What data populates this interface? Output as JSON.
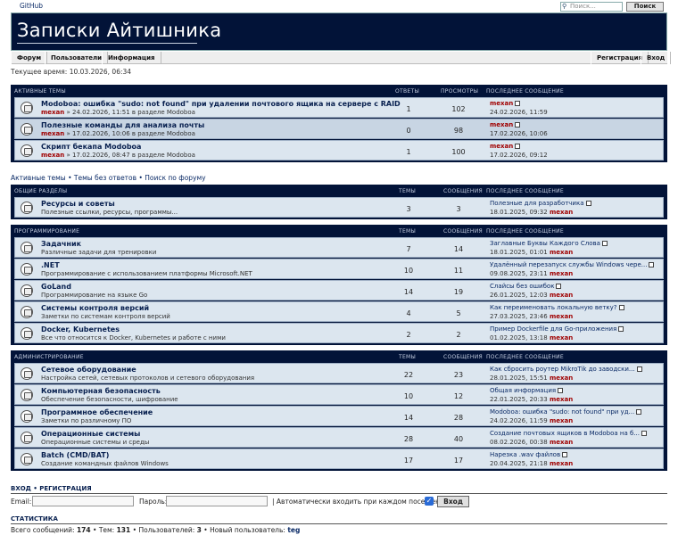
{
  "top": {
    "github": "GitHub",
    "search_placeholder": "Поиск...",
    "search_button": "Поиск"
  },
  "site_title": "Записки Айтишника",
  "nav": {
    "forum": "Форум",
    "users": "Пользователи",
    "info": "Информация",
    "register": "Регистрация",
    "login": "Вход"
  },
  "current_time": "Текущее время: 10.03.2026, 06:34",
  "active": {
    "headers": {
      "section": "АКТИВНЫЕ ТЕМЫ",
      "replies": "ОТВЕТЫ",
      "views": "ПРОСМОТРЫ",
      "last": "ПОСЛЕДНЕЕ СООБЩЕНИЕ"
    },
    "topics": [
      {
        "title": "Modoboa: ошибка \"sudo: not found\" при удалении почтового ящика на сервере с RAID",
        "author": "mexan",
        "info": " » 24.02.2026, 11:51 в разделе Modoboa",
        "replies": "1",
        "views": "102",
        "last_user": "mexan",
        "last_date": "24.02.2026, 11:59"
      },
      {
        "title": "Полезные команды для анализа почты",
        "author": "mexan",
        "info": " » 17.02.2026, 10:06 в разделе Modoboa",
        "replies": "0",
        "views": "98",
        "last_user": "mexan",
        "last_date": "17.02.2026, 10:06"
      },
      {
        "title": "Скрипт бекапа Modoboa",
        "author": "mexan",
        "info": " » 17.02.2026, 08:47 в разделе Modoboa",
        "replies": "1",
        "views": "100",
        "last_user": "mexan",
        "last_date": "17.02.2026, 09:12"
      }
    ]
  },
  "links": {
    "active": "Активные темы",
    "unanswered": "Темы без ответов",
    "search": "Поиск по форуму",
    "sep": " • "
  },
  "cols": {
    "topics": "ТЕМЫ",
    "posts": "СООБЩЕНИЯ",
    "last": "ПОСЛЕДНЕЕ СООБЩЕНИЕ"
  },
  "cat1": {
    "name": "ОБЩИЕ РАЗДЕЛЫ",
    "forums": [
      {
        "title": "Ресурсы и советы",
        "desc": "Полезные ссылки, ресурсы, программы...",
        "topics": "3",
        "posts": "3",
        "last_title": "Полезные для разработчика",
        "last_date": "18.01.2025, 09:32",
        "last_user": "mexan"
      }
    ]
  },
  "cat2": {
    "name": "ПРОГРАММИРОВАНИЕ",
    "forums": [
      {
        "title": "Задачник",
        "desc": "Различные задачи для тренировки",
        "topics": "7",
        "posts": "14",
        "last_title": "Заглавные Буквы Каждого Слова",
        "last_date": "18.01.2025, 01:01",
        "last_user": "mexan"
      },
      {
        "title": ".NET",
        "desc": "Программирование с использованием платформы Microsoft.NET",
        "topics": "10",
        "posts": "11",
        "last_title": "Удалённый перезапуск службы Windows чере...",
        "last_date": "09.08.2025, 23:11",
        "last_user": "mexan"
      },
      {
        "title": "GoLand",
        "desc": "Программирование на языке Go",
        "topics": "14",
        "posts": "19",
        "last_title": "Слайсы без ошибок",
        "last_date": "26.01.2025, 12:03",
        "last_user": "mexan"
      },
      {
        "title": "Системы контроля версий",
        "desc": "Заметки по системам контроля версий",
        "topics": "4",
        "posts": "5",
        "last_title": "Как переименовать локальную ветку?",
        "last_date": "27.03.2025, 23:46",
        "last_user": "mexan"
      },
      {
        "title": "Docker, Kubernetes",
        "desc": "Все что относится к Docker, Kubernetes и работе с ними",
        "topics": "2",
        "posts": "2",
        "last_title": "Пример Dockerfile для Go-приложения",
        "last_date": "01.02.2025, 13:18",
        "last_user": "mexan"
      }
    ]
  },
  "cat3": {
    "name": "АДМИНИСТРИРОВАНИЕ",
    "forums": [
      {
        "title": "Сетевое оборудование",
        "desc": "Настройка сетей, сетевых протоколов и сетевого оборудования",
        "topics": "22",
        "posts": "23",
        "last_title": "Как сбросить роутер MikroTik до заводски...",
        "last_date": "28.01.2025, 15:51",
        "last_user": "mexan"
      },
      {
        "title": "Компьютерная безопасность",
        "desc": "Обеспечение безопасности, шифрование",
        "topics": "10",
        "posts": "12",
        "last_title": "Общая информация",
        "last_date": "22.01.2025, 20:33",
        "last_user": "mexan"
      },
      {
        "title": "Программное обеспечение",
        "desc": "Заметки по различному ПО",
        "topics": "14",
        "posts": "28",
        "last_title": "Modoboa: ошибка \"sudo: not found\" при уд...",
        "last_date": "24.02.2026, 11:59",
        "last_user": "mexan"
      },
      {
        "title": "Операционные системы",
        "desc": "Операционные системы и среды",
        "topics": "28",
        "posts": "40",
        "last_title": "Создание почтовых ящиков в Modoboa на б...",
        "last_date": "08.02.2026, 00:38",
        "last_user": "mexan"
      },
      {
        "title": "Batch (CMD/BAT)",
        "desc": "Создание командных файлов Windows",
        "topics": "17",
        "posts": "17",
        "last_title": "Нарезка .wav файлов",
        "last_date": "20.04.2025, 21:18",
        "last_user": "mexan"
      }
    ]
  },
  "login": {
    "heading": "ВХОД • РЕГИСТРАЦИЯ",
    "email": "Email:",
    "password": "Пароль:",
    "auto": "| Автоматически входить при каждом посещении",
    "button": "Вход"
  },
  "stats": {
    "heading": "СТАТИСТИКА",
    "text": "Всего сообщений: ",
    "posts": "174",
    "t2": " • Тем: ",
    "topics": "131",
    "t3": " • Пользователей: ",
    "users": "3",
    "t4": " • Новый пользователь: ",
    "newest": "teg"
  }
}
